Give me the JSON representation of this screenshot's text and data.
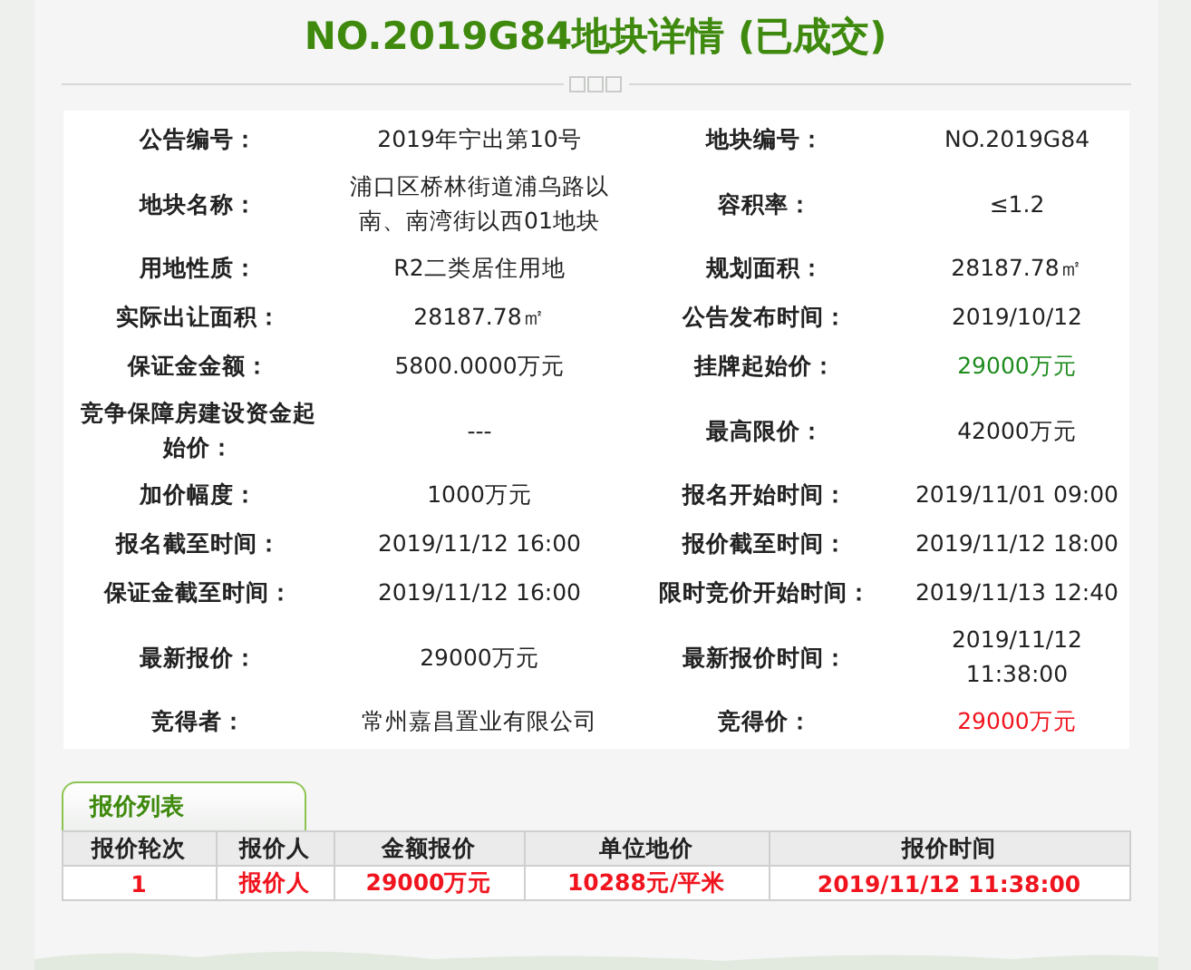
{
  "title": "NO.2019G84地块详情 (已成交)",
  "details": [
    {
      "fields": [
        {
          "label": "公告编号：",
          "value": "2019年宁出第10号"
        },
        {
          "label": "地块编号：",
          "value": "NO.2019G84"
        }
      ]
    },
    {
      "fields": [
        {
          "label": "地块名称：",
          "value": "浦口区桥林街道浦乌路以南、南湾街以西01地块"
        },
        {
          "label": "容积率：",
          "value": "≤1.2"
        }
      ]
    },
    {
      "fields": [
        {
          "label": "用地性质：",
          "value": "R2二类居住用地"
        },
        {
          "label": "规划面积：",
          "value": "28187.78㎡"
        }
      ]
    },
    {
      "fields": [
        {
          "label": "实际出让面积：",
          "value": "28187.78㎡"
        },
        {
          "label": "公告发布时间：",
          "value": "2019/10/12"
        }
      ]
    },
    {
      "fields": [
        {
          "label": "保证金金额：",
          "value": "5800.0000万元"
        },
        {
          "label": "挂牌起始价：",
          "value": "29000万元",
          "color": "#1e8c1e"
        }
      ]
    },
    {
      "fields": [
        {
          "label": "竞争保障房建设资金起始价：",
          "value": "---"
        },
        {
          "label": "最高限价：",
          "value": "42000万元"
        }
      ]
    },
    {
      "fields": [
        {
          "label": "加价幅度：",
          "value": "1000万元"
        },
        {
          "label": "报名开始时间：",
          "value": "2019/11/01 09:00"
        }
      ]
    },
    {
      "fields": [
        {
          "label": "报名截至时间：",
          "value": "2019/11/12 16:00"
        },
        {
          "label": "报价截至时间：",
          "value": "2019/11/12 18:00"
        }
      ]
    },
    {
      "fields": [
        {
          "label": "保证金截至时间：",
          "value": "2019/11/12 16:00"
        },
        {
          "label": "限时竞价开始时间：",
          "value": "2019/11/13 12:40"
        }
      ]
    },
    {
      "fields": [
        {
          "label": "最新报价：",
          "value": "29000万元"
        },
        {
          "label": "最新报价时间：",
          "value": "2019/11/12 11:38:00"
        }
      ]
    },
    {
      "fields": [
        {
          "label": "竞得者：",
          "value": "常州嘉昌置业有限公司"
        },
        {
          "label": "竞得价：",
          "value": "29000万元",
          "color": "#f0141e"
        }
      ]
    }
  ],
  "bids": {
    "tab": "报价列表",
    "columns": [
      "报价轮次",
      "报价人",
      "金额报价",
      "单位地价",
      "报价时间"
    ],
    "rows": [
      [
        "1",
        "报价人",
        "29000万元",
        "10288元/平米",
        "2019/11/12 11:38:00"
      ]
    ]
  }
}
